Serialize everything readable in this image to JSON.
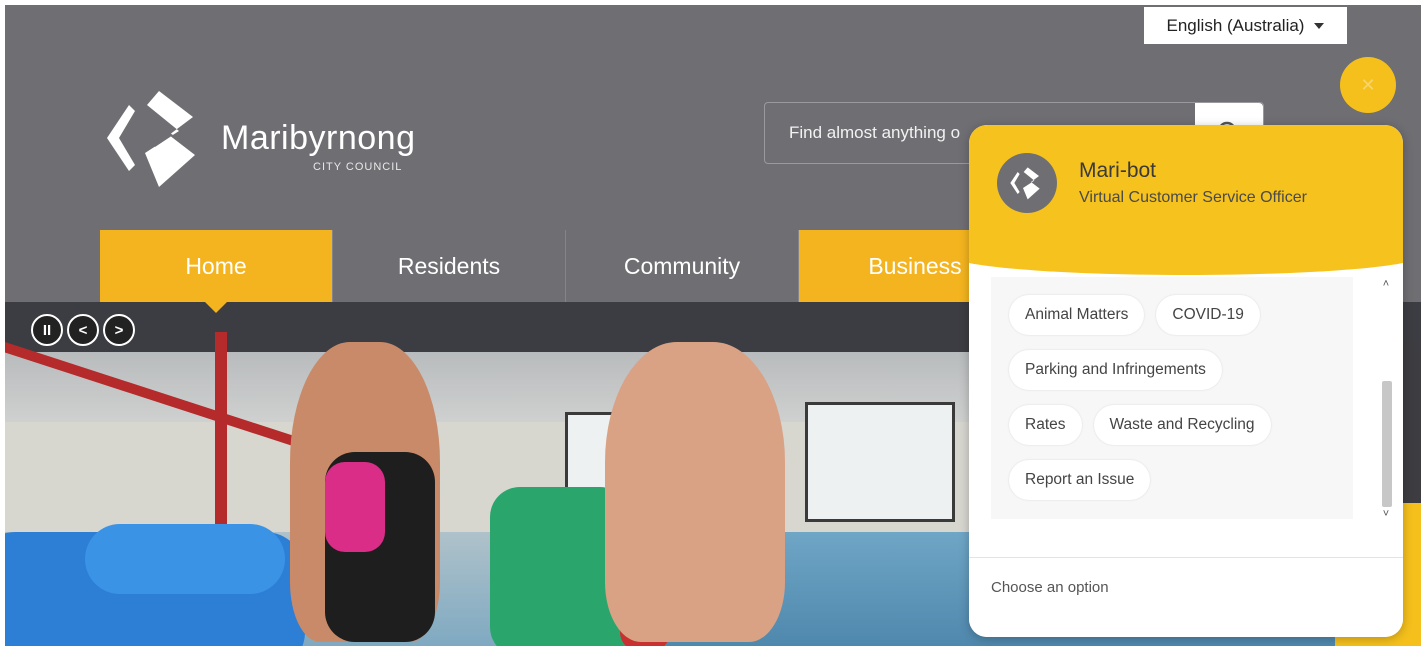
{
  "header": {
    "language": "English (Australia)",
    "logo": {
      "name": "Maribyrnong",
      "subtitle": "CITY COUNCIL"
    },
    "search": {
      "placeholder": "Find almost anything o"
    }
  },
  "nav": {
    "items": [
      {
        "label": "Home"
      },
      {
        "label": "Residents"
      },
      {
        "label": "Community"
      },
      {
        "label": "Business"
      }
    ]
  },
  "slider": {
    "pause": "II",
    "prev": "<",
    "next": ">"
  },
  "chatbot": {
    "launcher_icon": "close-icon",
    "name": "Mari-bot",
    "role": "Virtual Customer Service Officer",
    "options": [
      "Animal Matters",
      "COVID-19",
      "Parking and Infringements",
      "Rates",
      "Waste and Recycling",
      "Report an Issue"
    ],
    "input_placeholder": "Choose an option"
  },
  "colors": {
    "header_bg": "#6f6e73",
    "accent": "#f4b41f",
    "chat_header": "#f6c21d"
  }
}
